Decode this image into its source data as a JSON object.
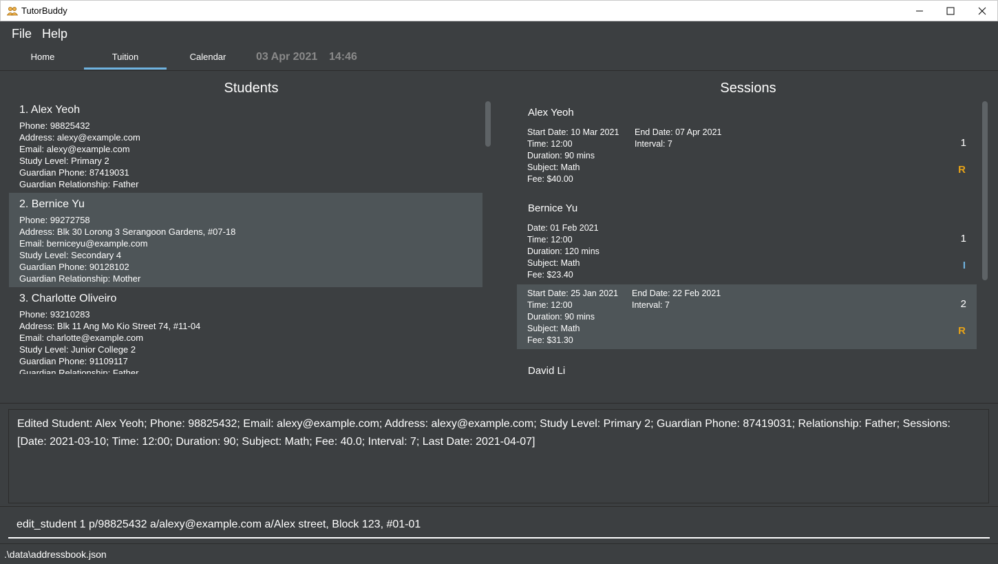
{
  "window": {
    "title": "TutorBuddy",
    "icon": "people-icon",
    "controls": [
      "minimize-icon",
      "maximize-icon",
      "close-icon"
    ]
  },
  "menu": {
    "items": [
      "File",
      "Help"
    ]
  },
  "tabs": {
    "items": [
      "Home",
      "Tuition",
      "Calendar"
    ],
    "active": "Tuition",
    "date": "03 Apr 2021",
    "time": "14:46"
  },
  "students": {
    "title": "Students",
    "items": [
      {
        "name": "1.  Alex Yeoh",
        "phone": "Phone: 98825432",
        "address": "Address: alexy@example.com",
        "email": "Email: alexy@example.com",
        "level": "Study Level: Primary 2",
        "guardian_phone": "Guardian Phone: 87419031",
        "relationship": "Guardian Relationship: Father"
      },
      {
        "name": "2.  Bernice Yu",
        "phone": "Phone: 99272758",
        "address": "Address: Blk 30 Lorong 3 Serangoon Gardens, #07-18",
        "email": "Email: berniceyu@example.com",
        "level": "Study Level: Secondary 4",
        "guardian_phone": "Guardian Phone: 90128102",
        "relationship": "Guardian Relationship: Mother"
      },
      {
        "name": "3.  Charlotte Oliveiro",
        "phone": "Phone: 93210283",
        "address": "Address: Blk 11 Ang Mo Kio Street 74, #11-04",
        "email": "Email: charlotte@example.com",
        "level": "Study Level: Junior College 2",
        "guardian_phone": "Guardian Phone: 91109117",
        "relationship": "Guardian Relationship: Father"
      }
    ]
  },
  "sessions": {
    "title": "Sessions",
    "groups": [
      {
        "owner": "Alex Yeoh",
        "cards": [
          {
            "start": "Start Date: 10 Mar 2021",
            "end": "End Date: 07 Apr 2021",
            "time": "Time: 12:00",
            "interval": "Interval: 7",
            "duration": "Duration: 90 mins",
            "subject": "Subject: Math",
            "fee": "Fee: $40.00",
            "index": "1",
            "tag": "R"
          }
        ]
      },
      {
        "owner": "Bernice Yu",
        "cards": [
          {
            "start": "Date: 01 Feb 2021",
            "end": "",
            "time": "Time: 12:00",
            "interval": "",
            "duration": "Duration: 120 mins",
            "subject": "Subject: Math",
            "fee": "Fee: $23.40",
            "index": "1",
            "tag": "I"
          },
          {
            "start": "Start Date: 25 Jan 2021",
            "end": "End Date: 22 Feb 2021",
            "time": "Time: 12:00",
            "interval": "Interval: 7",
            "duration": "Duration: 90 mins",
            "subject": "Subject: Math",
            "fee": "Fee: $31.30",
            "index": "2",
            "tag": "R"
          }
        ]
      },
      {
        "owner": "David Li",
        "cards": []
      }
    ]
  },
  "colors": {
    "background": "#3c3f41",
    "card_alt": "#4e5558",
    "tab_accent": "#6fb3e0",
    "tag_recurring": "#e8a317",
    "tag_individual": "#6fb3e0"
  },
  "result": {
    "text": "Edited Student: Alex Yeoh; Phone: 98825432; Email: alexy@example.com; Address: alexy@example.com; Study Level: Primary 2; Guardian Phone: 87419031; Relationship: Father; Sessions: [Date: 2021-03-10; Time: 12:00; Duration: 90; Subject: Math; Fee: 40.0; Interval: 7; Last Date: 2021-04-07]"
  },
  "command": {
    "value": "edit_student 1 p/98825432 a/alexy@example.com a/Alex street, Block 123, #01-01"
  },
  "status": {
    "path": ".\\data\\addressbook.json"
  }
}
